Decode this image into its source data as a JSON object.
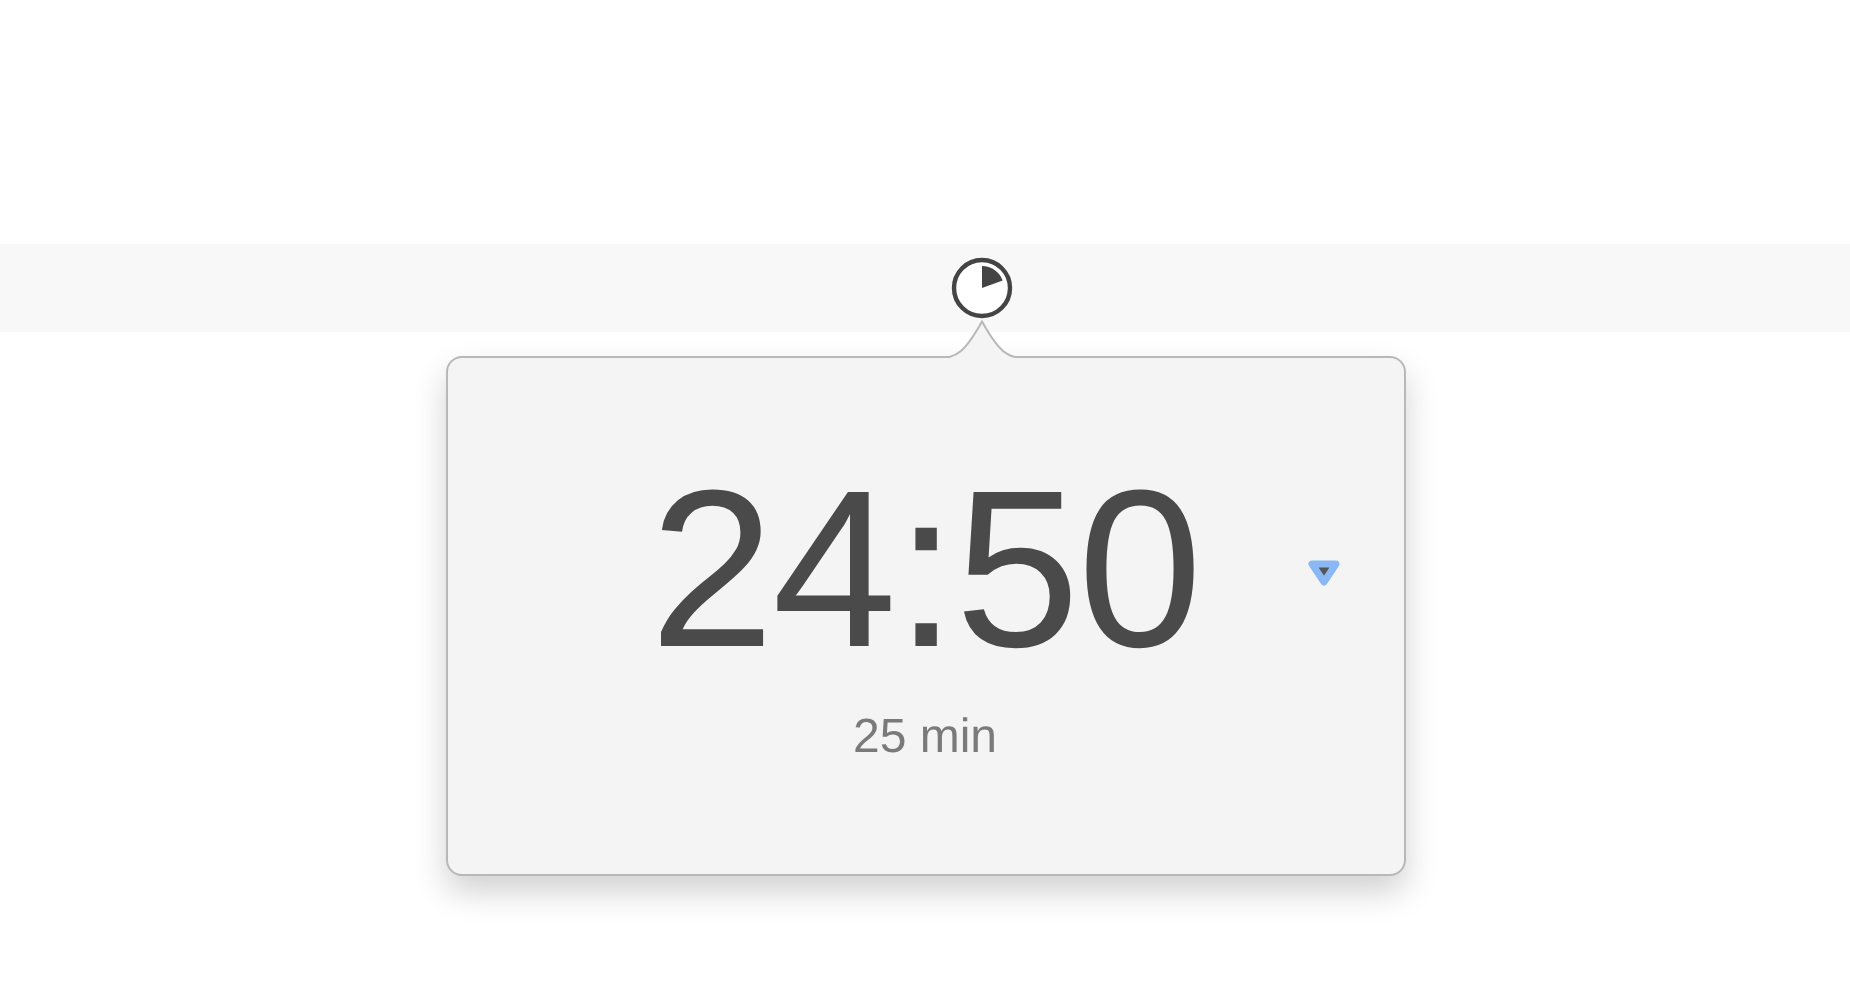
{
  "popover": {
    "time": "24:50",
    "duration": "25 min"
  }
}
